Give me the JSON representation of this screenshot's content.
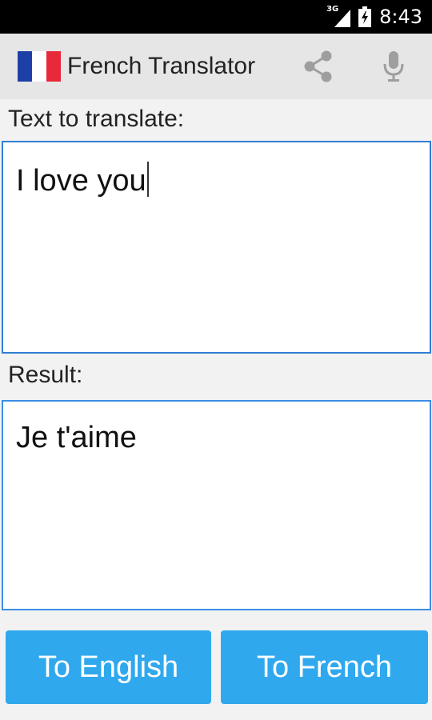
{
  "status_bar": {
    "network": "3G",
    "time": "8:43"
  },
  "app_bar": {
    "title": "French Translator",
    "flag_colors": [
      "#1f3fa8",
      "#ffffff",
      "#e8293b"
    ],
    "actions": [
      {
        "icon": "share-icon"
      },
      {
        "icon": "microphone-icon"
      }
    ]
  },
  "input": {
    "label": "Text to translate:",
    "value": "I love you"
  },
  "result": {
    "label": "Result:",
    "value": "Je t'aime"
  },
  "buttons": {
    "to_english": "To English",
    "to_french": "To French"
  },
  "colors": {
    "accent": "#2fa8ee",
    "border": "#2f7fd3",
    "icon_gray": "#9e9e9e"
  }
}
